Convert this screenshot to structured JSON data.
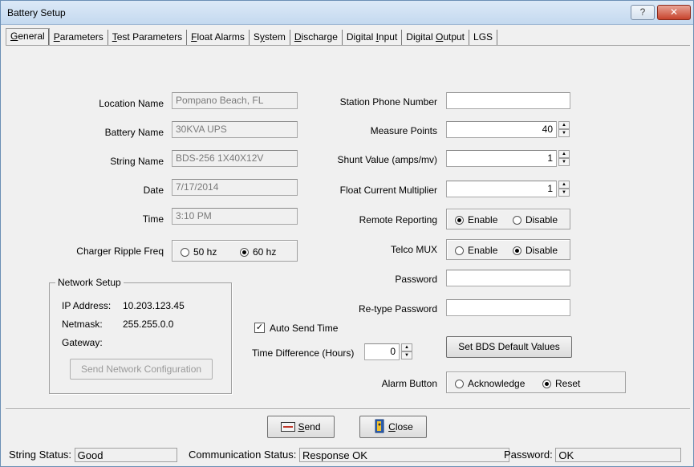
{
  "window": {
    "title": "Battery Setup",
    "help_label": "?",
    "close_label": "✕"
  },
  "tabs": [
    {
      "pre": "",
      "key": "G",
      "post": "eneral"
    },
    {
      "pre": "",
      "key": "P",
      "post": "arameters"
    },
    {
      "pre": "",
      "key": "T",
      "post": "est Parameters"
    },
    {
      "pre": "",
      "key": "F",
      "post": "loat Alarms"
    },
    {
      "pre": "S",
      "key": "y",
      "post": "stem"
    },
    {
      "pre": "",
      "key": "D",
      "post": "ischarge"
    },
    {
      "pre": "Digital ",
      "key": "I",
      "post": "nput"
    },
    {
      "pre": "Digital ",
      "key": "O",
      "post": "utput"
    },
    {
      "pre": "LGS",
      "key": "",
      "post": ""
    }
  ],
  "left": {
    "location_name": {
      "label": "Location Name",
      "value": "Pompano Beach, FL"
    },
    "battery_name": {
      "label": "Battery Name",
      "value": "30KVA UPS"
    },
    "string_name": {
      "label": "String Name",
      "value": "BDS-256 1X40X12V"
    },
    "date": {
      "label": "Date",
      "value": "7/17/2014"
    },
    "time": {
      "label": "Time",
      "value": "3:10 PM"
    },
    "ripple": {
      "label": "Charger Ripple Freq",
      "opt1": "50 hz",
      "opt2": "60 hz",
      "selected": "60 hz"
    }
  },
  "network": {
    "title": "Network Setup",
    "ip_label": "IP Address:",
    "ip_value": "10.203.123.45",
    "netmask_label": "Netmask:",
    "netmask_value": "255.255.0.0",
    "gateway_label": "Gateway:",
    "send_button": "Send Network Configuration"
  },
  "right": {
    "phone": {
      "label": "Station Phone Number",
      "value": ""
    },
    "measure_points": {
      "label": "Measure Points",
      "value": "40"
    },
    "shunt": {
      "label": "Shunt Value (amps/mv)",
      "value": "1"
    },
    "float_mult": {
      "label": "Float Current Multiplier",
      "value": "1"
    },
    "remote": {
      "label": "Remote Reporting",
      "opt1": "Enable",
      "opt2": "Disable",
      "selected": "Enable"
    },
    "telco": {
      "label": "Telco MUX",
      "opt1": "Enable",
      "opt2": "Disable",
      "selected": "Disable"
    },
    "password": {
      "label": "Password",
      "value": ""
    },
    "retype": {
      "label": "Re-type Password",
      "value": ""
    },
    "default_button": "Set BDS Default Values",
    "alarm": {
      "label": "Alarm Button",
      "opt1": "Acknowledge",
      "opt2": "Reset",
      "selected": "Reset"
    }
  },
  "auto_send": {
    "label": "Auto Send Time",
    "checked": true
  },
  "time_diff": {
    "label": "Time Difference (Hours)",
    "value": "0"
  },
  "footer": {
    "send_pre": "",
    "send_key": "S",
    "send_post": "end",
    "close_pre": "",
    "close_key": "C",
    "close_post": "lose"
  },
  "status": {
    "string_label": "String Status:",
    "string_value": "Good",
    "comm_label": "Communication Status:",
    "comm_value": "Response OK",
    "pw_label": "Password:",
    "pw_value": "OK"
  },
  "spin_up": "▲",
  "spin_down": "▼",
  "check_mark": "✓"
}
